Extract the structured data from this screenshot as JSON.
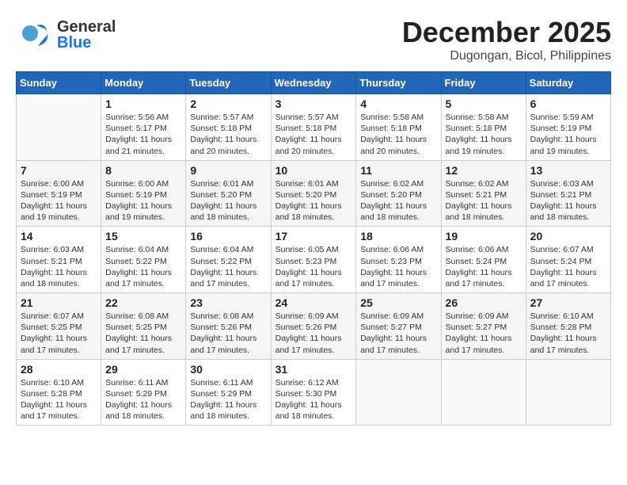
{
  "header": {
    "logo_general": "General",
    "logo_blue": "Blue",
    "month": "December 2025",
    "location": "Dugongan, Bicol, Philippines"
  },
  "days_of_week": [
    "Sunday",
    "Monday",
    "Tuesday",
    "Wednesday",
    "Thursday",
    "Friday",
    "Saturday"
  ],
  "weeks": [
    [
      {
        "day": "",
        "info": ""
      },
      {
        "day": "1",
        "info": "Sunrise: 5:56 AM\nSunset: 5:17 PM\nDaylight: 11 hours\nand 21 minutes."
      },
      {
        "day": "2",
        "info": "Sunrise: 5:57 AM\nSunset: 5:18 PM\nDaylight: 11 hours\nand 20 minutes."
      },
      {
        "day": "3",
        "info": "Sunrise: 5:57 AM\nSunset: 5:18 PM\nDaylight: 11 hours\nand 20 minutes."
      },
      {
        "day": "4",
        "info": "Sunrise: 5:58 AM\nSunset: 5:18 PM\nDaylight: 11 hours\nand 20 minutes."
      },
      {
        "day": "5",
        "info": "Sunrise: 5:58 AM\nSunset: 5:18 PM\nDaylight: 11 hours\nand 19 minutes."
      },
      {
        "day": "6",
        "info": "Sunrise: 5:59 AM\nSunset: 5:19 PM\nDaylight: 11 hours\nand 19 minutes."
      }
    ],
    [
      {
        "day": "7",
        "info": "Sunrise: 6:00 AM\nSunset: 5:19 PM\nDaylight: 11 hours\nand 19 minutes."
      },
      {
        "day": "8",
        "info": "Sunrise: 6:00 AM\nSunset: 5:19 PM\nDaylight: 11 hours\nand 19 minutes."
      },
      {
        "day": "9",
        "info": "Sunrise: 6:01 AM\nSunset: 5:20 PM\nDaylight: 11 hours\nand 18 minutes."
      },
      {
        "day": "10",
        "info": "Sunrise: 6:01 AM\nSunset: 5:20 PM\nDaylight: 11 hours\nand 18 minutes."
      },
      {
        "day": "11",
        "info": "Sunrise: 6:02 AM\nSunset: 5:20 PM\nDaylight: 11 hours\nand 18 minutes."
      },
      {
        "day": "12",
        "info": "Sunrise: 6:02 AM\nSunset: 5:21 PM\nDaylight: 11 hours\nand 18 minutes."
      },
      {
        "day": "13",
        "info": "Sunrise: 6:03 AM\nSunset: 5:21 PM\nDaylight: 11 hours\nand 18 minutes."
      }
    ],
    [
      {
        "day": "14",
        "info": "Sunrise: 6:03 AM\nSunset: 5:21 PM\nDaylight: 11 hours\nand 18 minutes."
      },
      {
        "day": "15",
        "info": "Sunrise: 6:04 AM\nSunset: 5:22 PM\nDaylight: 11 hours\nand 17 minutes."
      },
      {
        "day": "16",
        "info": "Sunrise: 6:04 AM\nSunset: 5:22 PM\nDaylight: 11 hours\nand 17 minutes."
      },
      {
        "day": "17",
        "info": "Sunrise: 6:05 AM\nSunset: 5:23 PM\nDaylight: 11 hours\nand 17 minutes."
      },
      {
        "day": "18",
        "info": "Sunrise: 6:06 AM\nSunset: 5:23 PM\nDaylight: 11 hours\nand 17 minutes."
      },
      {
        "day": "19",
        "info": "Sunrise: 6:06 AM\nSunset: 5:24 PM\nDaylight: 11 hours\nand 17 minutes."
      },
      {
        "day": "20",
        "info": "Sunrise: 6:07 AM\nSunset: 5:24 PM\nDaylight: 11 hours\nand 17 minutes."
      }
    ],
    [
      {
        "day": "21",
        "info": "Sunrise: 6:07 AM\nSunset: 5:25 PM\nDaylight: 11 hours\nand 17 minutes."
      },
      {
        "day": "22",
        "info": "Sunrise: 6:08 AM\nSunset: 5:25 PM\nDaylight: 11 hours\nand 17 minutes."
      },
      {
        "day": "23",
        "info": "Sunrise: 6:08 AM\nSunset: 5:26 PM\nDaylight: 11 hours\nand 17 minutes."
      },
      {
        "day": "24",
        "info": "Sunrise: 6:09 AM\nSunset: 5:26 PM\nDaylight: 11 hours\nand 17 minutes."
      },
      {
        "day": "25",
        "info": "Sunrise: 6:09 AM\nSunset: 5:27 PM\nDaylight: 11 hours\nand 17 minutes."
      },
      {
        "day": "26",
        "info": "Sunrise: 6:09 AM\nSunset: 5:27 PM\nDaylight: 11 hours\nand 17 minutes."
      },
      {
        "day": "27",
        "info": "Sunrise: 6:10 AM\nSunset: 5:28 PM\nDaylight: 11 hours\nand 17 minutes."
      }
    ],
    [
      {
        "day": "28",
        "info": "Sunrise: 6:10 AM\nSunset: 5:28 PM\nDaylight: 11 hours\nand 17 minutes."
      },
      {
        "day": "29",
        "info": "Sunrise: 6:11 AM\nSunset: 5:29 PM\nDaylight: 11 hours\nand 18 minutes."
      },
      {
        "day": "30",
        "info": "Sunrise: 6:11 AM\nSunset: 5:29 PM\nDaylight: 11 hours\nand 18 minutes."
      },
      {
        "day": "31",
        "info": "Sunrise: 6:12 AM\nSunset: 5:30 PM\nDaylight: 11 hours\nand 18 minutes."
      },
      {
        "day": "",
        "info": ""
      },
      {
        "day": "",
        "info": ""
      },
      {
        "day": "",
        "info": ""
      }
    ]
  ]
}
